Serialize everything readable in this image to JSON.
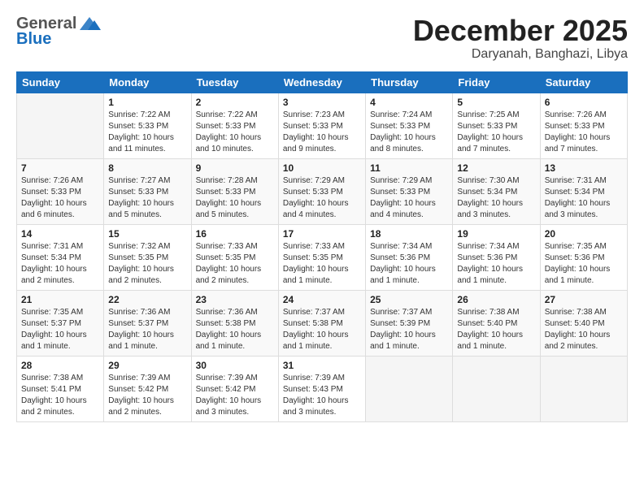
{
  "logo": {
    "general": "General",
    "blue": "Blue"
  },
  "title": {
    "month": "December 2025",
    "location": "Daryanah, Banghazi, Libya"
  },
  "weekdays": [
    "Sunday",
    "Monday",
    "Tuesday",
    "Wednesday",
    "Thursday",
    "Friday",
    "Saturday"
  ],
  "weeks": [
    [
      {
        "day": "",
        "info": ""
      },
      {
        "day": "1",
        "info": "Sunrise: 7:22 AM\nSunset: 5:33 PM\nDaylight: 10 hours\nand 11 minutes."
      },
      {
        "day": "2",
        "info": "Sunrise: 7:22 AM\nSunset: 5:33 PM\nDaylight: 10 hours\nand 10 minutes."
      },
      {
        "day": "3",
        "info": "Sunrise: 7:23 AM\nSunset: 5:33 PM\nDaylight: 10 hours\nand 9 minutes."
      },
      {
        "day": "4",
        "info": "Sunrise: 7:24 AM\nSunset: 5:33 PM\nDaylight: 10 hours\nand 8 minutes."
      },
      {
        "day": "5",
        "info": "Sunrise: 7:25 AM\nSunset: 5:33 PM\nDaylight: 10 hours\nand 7 minutes."
      },
      {
        "day": "6",
        "info": "Sunrise: 7:26 AM\nSunset: 5:33 PM\nDaylight: 10 hours\nand 7 minutes."
      }
    ],
    [
      {
        "day": "7",
        "info": "Sunrise: 7:26 AM\nSunset: 5:33 PM\nDaylight: 10 hours\nand 6 minutes."
      },
      {
        "day": "8",
        "info": "Sunrise: 7:27 AM\nSunset: 5:33 PM\nDaylight: 10 hours\nand 5 minutes."
      },
      {
        "day": "9",
        "info": "Sunrise: 7:28 AM\nSunset: 5:33 PM\nDaylight: 10 hours\nand 5 minutes."
      },
      {
        "day": "10",
        "info": "Sunrise: 7:29 AM\nSunset: 5:33 PM\nDaylight: 10 hours\nand 4 minutes."
      },
      {
        "day": "11",
        "info": "Sunrise: 7:29 AM\nSunset: 5:33 PM\nDaylight: 10 hours\nand 4 minutes."
      },
      {
        "day": "12",
        "info": "Sunrise: 7:30 AM\nSunset: 5:34 PM\nDaylight: 10 hours\nand 3 minutes."
      },
      {
        "day": "13",
        "info": "Sunrise: 7:31 AM\nSunset: 5:34 PM\nDaylight: 10 hours\nand 3 minutes."
      }
    ],
    [
      {
        "day": "14",
        "info": "Sunrise: 7:31 AM\nSunset: 5:34 PM\nDaylight: 10 hours\nand 2 minutes."
      },
      {
        "day": "15",
        "info": "Sunrise: 7:32 AM\nSunset: 5:35 PM\nDaylight: 10 hours\nand 2 minutes."
      },
      {
        "day": "16",
        "info": "Sunrise: 7:33 AM\nSunset: 5:35 PM\nDaylight: 10 hours\nand 2 minutes."
      },
      {
        "day": "17",
        "info": "Sunrise: 7:33 AM\nSunset: 5:35 PM\nDaylight: 10 hours\nand 1 minute."
      },
      {
        "day": "18",
        "info": "Sunrise: 7:34 AM\nSunset: 5:36 PM\nDaylight: 10 hours\nand 1 minute."
      },
      {
        "day": "19",
        "info": "Sunrise: 7:34 AM\nSunset: 5:36 PM\nDaylight: 10 hours\nand 1 minute."
      },
      {
        "day": "20",
        "info": "Sunrise: 7:35 AM\nSunset: 5:36 PM\nDaylight: 10 hours\nand 1 minute."
      }
    ],
    [
      {
        "day": "21",
        "info": "Sunrise: 7:35 AM\nSunset: 5:37 PM\nDaylight: 10 hours\nand 1 minute."
      },
      {
        "day": "22",
        "info": "Sunrise: 7:36 AM\nSunset: 5:37 PM\nDaylight: 10 hours\nand 1 minute."
      },
      {
        "day": "23",
        "info": "Sunrise: 7:36 AM\nSunset: 5:38 PM\nDaylight: 10 hours\nand 1 minute."
      },
      {
        "day": "24",
        "info": "Sunrise: 7:37 AM\nSunset: 5:38 PM\nDaylight: 10 hours\nand 1 minute."
      },
      {
        "day": "25",
        "info": "Sunrise: 7:37 AM\nSunset: 5:39 PM\nDaylight: 10 hours\nand 1 minute."
      },
      {
        "day": "26",
        "info": "Sunrise: 7:38 AM\nSunset: 5:40 PM\nDaylight: 10 hours\nand 1 minute."
      },
      {
        "day": "27",
        "info": "Sunrise: 7:38 AM\nSunset: 5:40 PM\nDaylight: 10 hours\nand 2 minutes."
      }
    ],
    [
      {
        "day": "28",
        "info": "Sunrise: 7:38 AM\nSunset: 5:41 PM\nDaylight: 10 hours\nand 2 minutes."
      },
      {
        "day": "29",
        "info": "Sunrise: 7:39 AM\nSunset: 5:42 PM\nDaylight: 10 hours\nand 2 minutes."
      },
      {
        "day": "30",
        "info": "Sunrise: 7:39 AM\nSunset: 5:42 PM\nDaylight: 10 hours\nand 3 minutes."
      },
      {
        "day": "31",
        "info": "Sunrise: 7:39 AM\nSunset: 5:43 PM\nDaylight: 10 hours\nand 3 minutes."
      },
      {
        "day": "",
        "info": ""
      },
      {
        "day": "",
        "info": ""
      },
      {
        "day": "",
        "info": ""
      }
    ]
  ]
}
